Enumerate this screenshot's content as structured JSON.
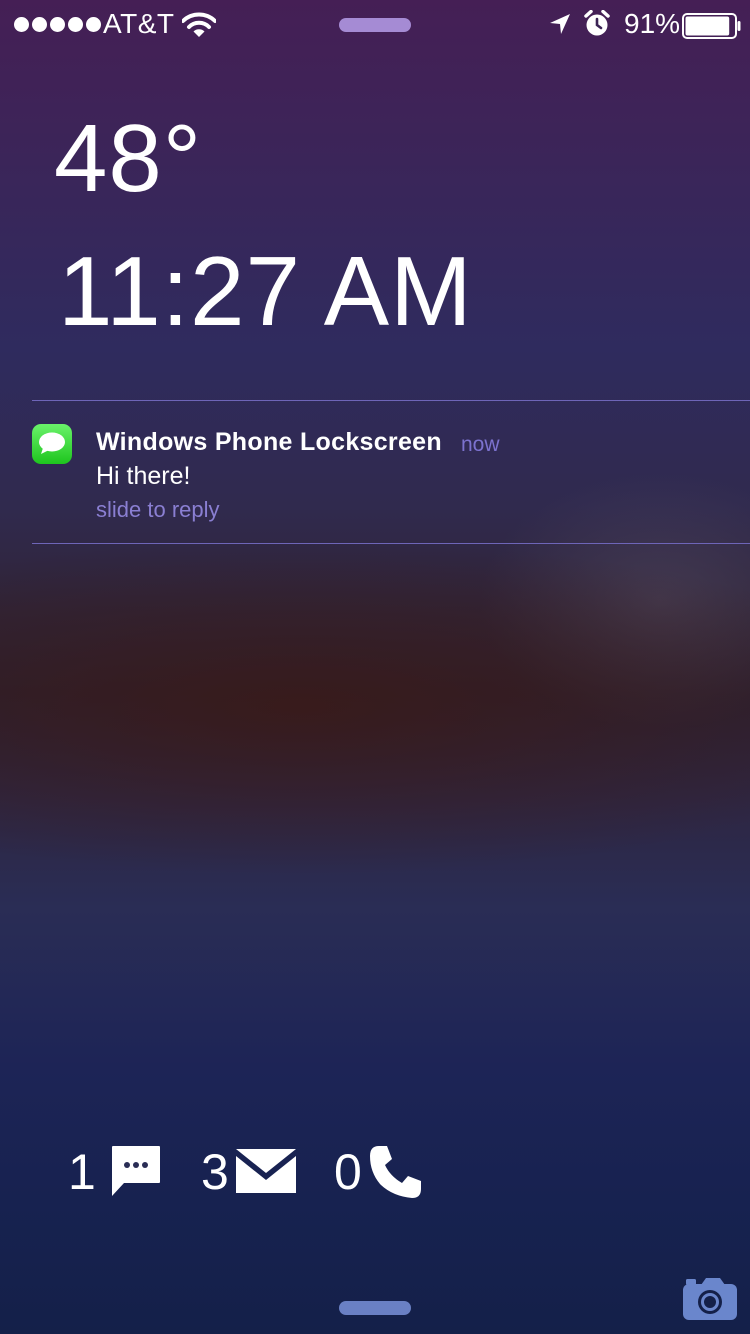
{
  "status_bar": {
    "carrier": "AT&T",
    "battery_percent": "91%",
    "battery_level": 0.91,
    "signal_bars": 5,
    "icons": [
      "signal-dots-icon",
      "wifi-icon",
      "location-arrow-icon",
      "alarm-clock-icon",
      "battery-icon"
    ]
  },
  "weather": {
    "temperature": "48°"
  },
  "clock": {
    "time": "11:27 AM"
  },
  "notification": {
    "app_icon": "messages-icon",
    "title": "Windows Phone Lockscreen",
    "time": "now",
    "body": "Hi there!",
    "action": "slide to reply"
  },
  "counters": [
    {
      "count": "1",
      "icon": "message-bubble-icon"
    },
    {
      "count": "3",
      "icon": "mail-envelope-icon"
    },
    {
      "count": "0",
      "icon": "phone-handset-icon"
    }
  ],
  "camera": {
    "icon": "camera-icon"
  },
  "colors": {
    "accent_text": "#8a7fd2",
    "divider": "#6e65b8",
    "top_grabber": "#a58bd4",
    "bottom_grabber": "#6a80c4",
    "camera": "#6a86cc"
  }
}
